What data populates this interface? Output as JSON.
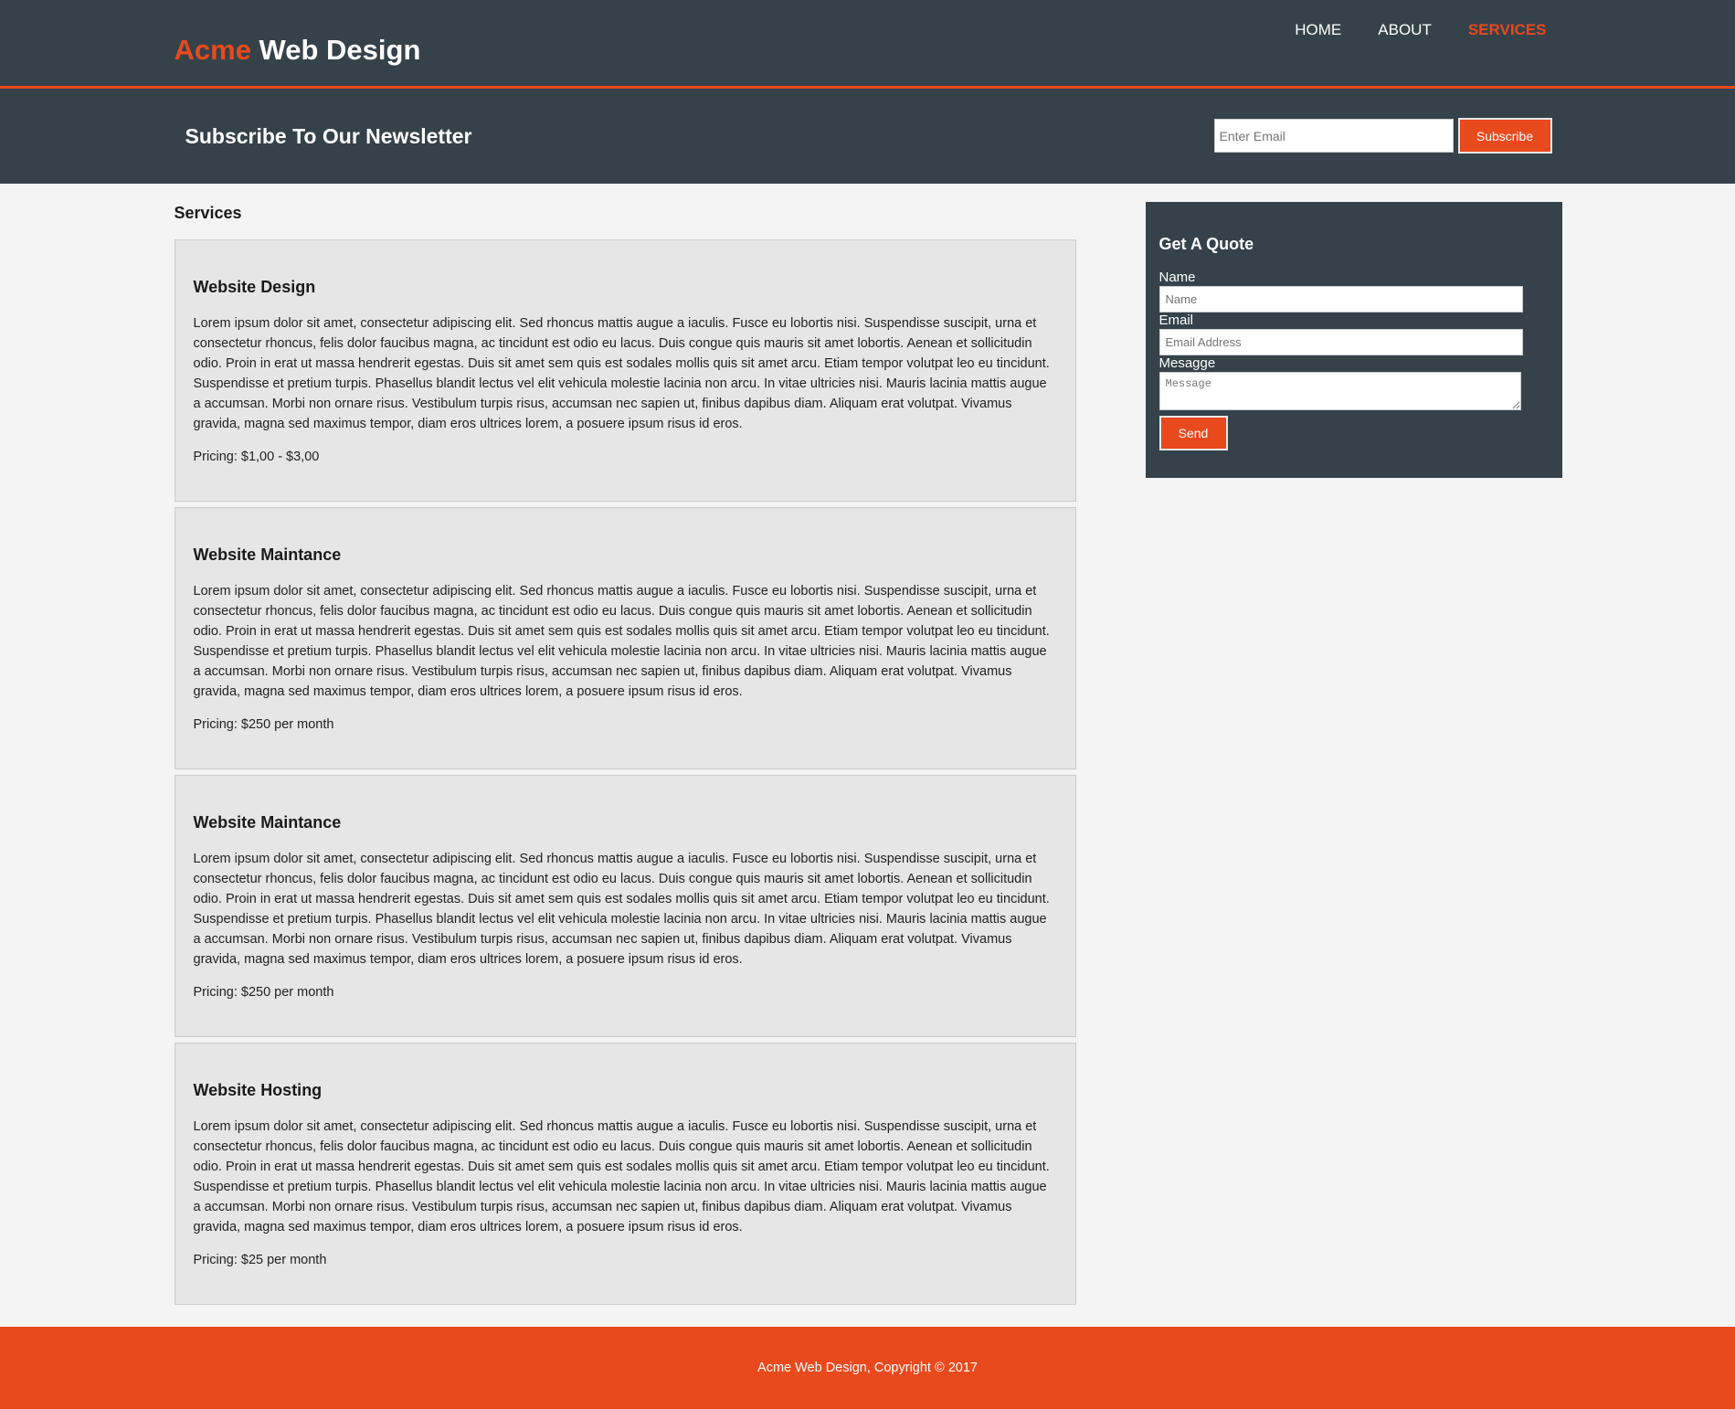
{
  "header": {
    "logo_highlight": "Acme",
    "logo_rest": " Web Design",
    "nav": [
      {
        "label": "HOME"
      },
      {
        "label": "ABOUT"
      },
      {
        "label": "SERVICES"
      }
    ]
  },
  "newsletter": {
    "title": "Subscribe To Our Newsletter",
    "email_placeholder": "Enter Email",
    "subscribe_label": "Subscribe"
  },
  "services": {
    "title": "Services",
    "items": [
      {
        "title": "Website Design",
        "description": "Lorem ipsum dolor sit amet, consectetur adipiscing elit. Sed rhoncus mattis augue a iaculis. Fusce eu lobortis nisi. Suspendisse suscipit, urna et consectetur rhoncus, felis dolor faucibus magna, ac tincidunt est odio eu lacus. Duis congue quis mauris sit amet lobortis. Aenean et sollicitudin odio. Proin in erat ut massa hendrerit egestas. Duis sit amet sem quis est sodales mollis quis sit amet arcu. Etiam tempor volutpat leo eu tincidunt. Suspendisse et pretium turpis. Phasellus blandit lectus vel elit vehicula molestie lacinia non arcu. In vitae ultricies nisi. Mauris lacinia mattis augue a accumsan. Morbi non ornare risus. Vestibulum turpis risus, accumsan nec sapien ut, finibus dapibus diam. Aliquam erat volutpat. Vivamus gravida, magna sed maximus tempor, diam eros ultrices lorem, a posuere ipsum risus id eros.",
        "pricing": "Pricing: $1,00 - $3,00"
      },
      {
        "title": "Website Maintance",
        "description": "Lorem ipsum dolor sit amet, consectetur adipiscing elit. Sed rhoncus mattis augue a iaculis. Fusce eu lobortis nisi. Suspendisse suscipit, urna et consectetur rhoncus, felis dolor faucibus magna, ac tincidunt est odio eu lacus. Duis congue quis mauris sit amet lobortis. Aenean et sollicitudin odio. Proin in erat ut massa hendrerit egestas. Duis sit amet sem quis est sodales mollis quis sit amet arcu. Etiam tempor volutpat leo eu tincidunt. Suspendisse et pretium turpis. Phasellus blandit lectus vel elit vehicula molestie lacinia non arcu. In vitae ultricies nisi. Mauris lacinia mattis augue a accumsan. Morbi non ornare risus. Vestibulum turpis risus, accumsan nec sapien ut, finibus dapibus diam. Aliquam erat volutpat. Vivamus gravida, magna sed maximus tempor, diam eros ultrices lorem, a posuere ipsum risus id eros.",
        "pricing": "Pricing: $250 per month"
      },
      {
        "title": "Website Maintance",
        "description": "Lorem ipsum dolor sit amet, consectetur adipiscing elit. Sed rhoncus mattis augue a iaculis. Fusce eu lobortis nisi. Suspendisse suscipit, urna et consectetur rhoncus, felis dolor faucibus magna, ac tincidunt est odio eu lacus. Duis congue quis mauris sit amet lobortis. Aenean et sollicitudin odio. Proin in erat ut massa hendrerit egestas. Duis sit amet sem quis est sodales mollis quis sit amet arcu. Etiam tempor volutpat leo eu tincidunt. Suspendisse et pretium turpis. Phasellus blandit lectus vel elit vehicula molestie lacinia non arcu. In vitae ultricies nisi. Mauris lacinia mattis augue a accumsan. Morbi non ornare risus. Vestibulum turpis risus, accumsan nec sapien ut, finibus dapibus diam. Aliquam erat volutpat. Vivamus gravida, magna sed maximus tempor, diam eros ultrices lorem, a posuere ipsum risus id eros.",
        "pricing": "Pricing: $250 per month"
      },
      {
        "title": "Website Hosting",
        "description": "Lorem ipsum dolor sit amet, consectetur adipiscing elit. Sed rhoncus mattis augue a iaculis. Fusce eu lobortis nisi. Suspendisse suscipit, urna et consectetur rhoncus, felis dolor faucibus magna, ac tincidunt est odio eu lacus. Duis congue quis mauris sit amet lobortis. Aenean et sollicitudin odio. Proin in erat ut massa hendrerit egestas. Duis sit amet sem quis est sodales mollis quis sit amet arcu. Etiam tempor volutpat leo eu tincidunt. Suspendisse et pretium turpis. Phasellus blandit lectus vel elit vehicula molestie lacinia non arcu. In vitae ultricies nisi. Mauris lacinia mattis augue a accumsan. Morbi non ornare risus. Vestibulum turpis risus, accumsan nec sapien ut, finibus dapibus diam. Aliquam erat volutpat. Vivamus gravida, magna sed maximus tempor, diam eros ultrices lorem, a posuere ipsum risus id eros.",
        "pricing": "Pricing: $25 per month"
      }
    ]
  },
  "quote": {
    "title": "Get A Quote",
    "name_label": "Name",
    "name_placeholder": "Name",
    "email_label": "Email",
    "email_placeholder": "Email Address",
    "message_label": "Mesagge",
    "message_placeholder": "Message",
    "send_label": "Send"
  },
  "footer": {
    "text": "Acme Web Design, Copyright © 2017"
  },
  "colors": {
    "dark": "#35424a",
    "accent": "#e8491d",
    "page_bg": "#f4f4f4",
    "card_bg": "#e6e6e6"
  }
}
